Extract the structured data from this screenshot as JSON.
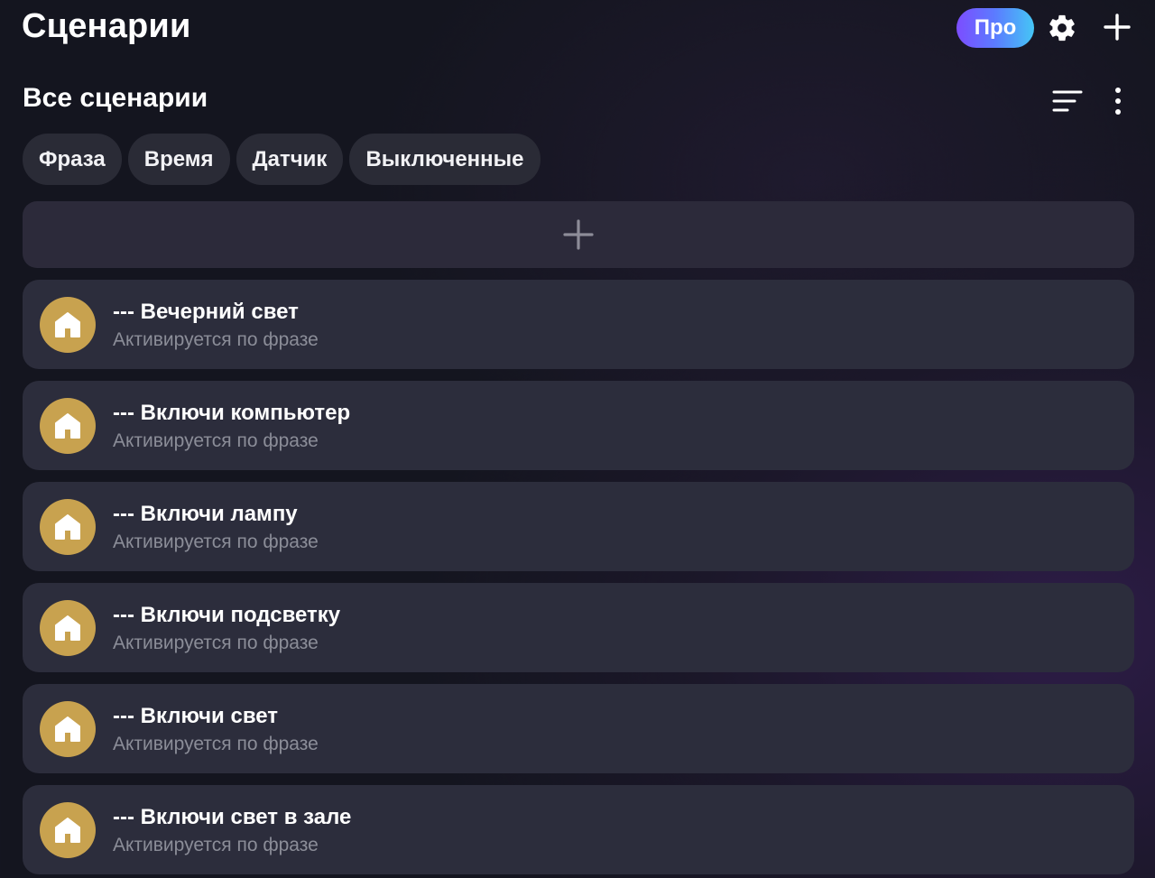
{
  "header": {
    "title": "Сценарии",
    "pro_label": "Про",
    "settings_icon": "gear-icon",
    "add_icon": "plus-icon"
  },
  "section": {
    "title": "Все сценарии",
    "sort_icon": "sort-icon",
    "more_icon": "more-vertical-icon"
  },
  "filters": [
    {
      "label": "Фраза"
    },
    {
      "label": "Время"
    },
    {
      "label": "Датчик"
    },
    {
      "label": "Выключенные"
    }
  ],
  "add_scenario_icon": "plus-icon",
  "scenarios": [
    {
      "title": "--- Вечерний свет",
      "subtitle": "Активируется по фразе",
      "icon": "home-icon"
    },
    {
      "title": "--- Включи компьютер",
      "subtitle": "Активируется по фразе",
      "icon": "home-icon"
    },
    {
      "title": "--- Включи лампу",
      "subtitle": "Активируется по фразе",
      "icon": "home-icon"
    },
    {
      "title": "--- Включи подсветку",
      "subtitle": "Активируется по фразе",
      "icon": "home-icon"
    },
    {
      "title": "--- Включи свет",
      "subtitle": "Активируется по фразе",
      "icon": "home-icon"
    },
    {
      "title": "--- Включи свет в зале",
      "subtitle": "Активируется по фразе",
      "icon": "home-icon"
    }
  ],
  "colors": {
    "background": "#14151f",
    "card": "#2c2d3c",
    "chip": "#2a2b36",
    "avatar": "#c8a24f",
    "subtitle": "#8b8d98",
    "pro_gradient_start": "#7c4dff",
    "pro_gradient_end": "#45c6f5"
  }
}
